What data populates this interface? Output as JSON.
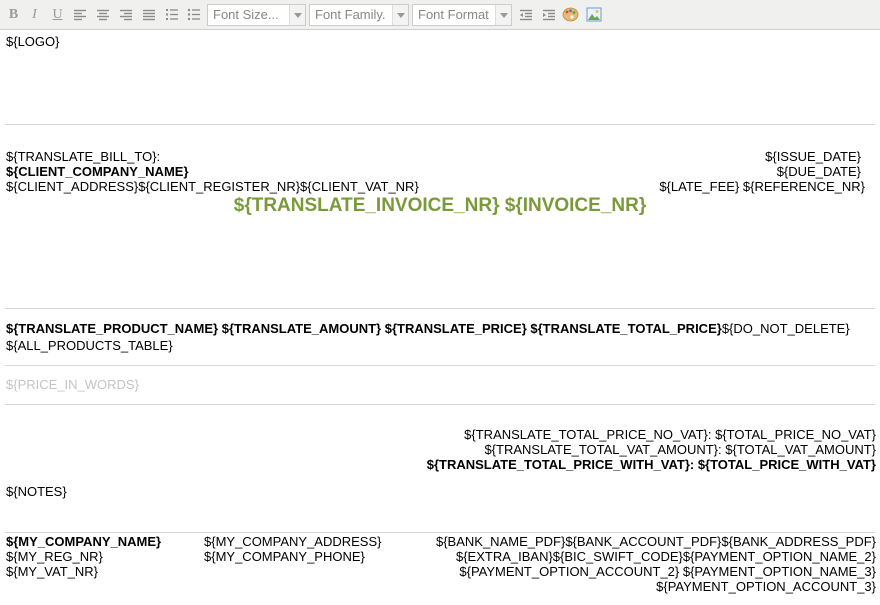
{
  "toolbar": {
    "font_size_placeholder": "Font Size...",
    "font_family_placeholder": "Font Family.",
    "font_format_placeholder": "Font Format",
    "icons": [
      "bold-icon",
      "italic-icon",
      "underline-icon",
      "align-left-icon",
      "align-center-icon",
      "align-right-icon",
      "justify-icon",
      "ordered-list-icon",
      "unordered-list-icon",
      "outdent-icon",
      "indent-icon",
      "color-palette-icon",
      "insert-image-icon"
    ]
  },
  "doc": {
    "logo": "${LOGO}",
    "bill_to": "${TRANSLATE_BILL_TO}:",
    "client_company": "${CLIENT_COMPANY_NAME}",
    "client_address": "${CLIENT_ADDRESS}${CLIENT_REGISTER_NR}${CLIENT_VAT_NR}",
    "issue_date": "${ISSUE_DATE}",
    "due_date": "${DUE_DATE}",
    "late_fee_ref": "${LATE_FEE} ${REFERENCE_NR}",
    "invoice_title": "${TRANSLATE_INVOICE_NR} ${INVOICE_NR}",
    "table_header_bold": "${TRANSLATE_PRODUCT_NAME} ${TRANSLATE_AMOUNT} ${TRANSLATE_PRICE} ${TRANSLATE_TOTAL_PRICE}",
    "table_header_rest": "${DO_NOT_DELETE}",
    "all_products": "${ALL_PRODUCTS_TABLE}",
    "price_in_words": "${PRICE_IN_WORDS}",
    "total_no_vat": "${TRANSLATE_TOTAL_PRICE_NO_VAT}: ${TOTAL_PRICE_NO_VAT}",
    "total_vat": "${TRANSLATE_TOTAL_VAT_AMOUNT}: ${TOTAL_VAT_AMOUNT}",
    "total_with_vat": "${TRANSLATE_TOTAL_PRICE_WITH_VAT}: ${TOTAL_PRICE_WITH_VAT}",
    "notes": "${NOTES}",
    "footer": {
      "col1": [
        "${MY_COMPANY_NAME}",
        "${MY_REG_NR}",
        "${MY_VAT_NR}"
      ],
      "col2": [
        "${MY_COMPANY_ADDRESS}",
        "${MY_COMPANY_PHONE}"
      ],
      "col3": [
        "${BANK_NAME_PDF}${BANK_ACCOUNT_PDF}${BANK_ADDRESS_PDF}",
        "${EXTRA_IBAN}${BIC_SWIFT_CODE}${PAYMENT_OPTION_NAME_2}",
        "${PAYMENT_OPTION_ACCOUNT_2} ${PAYMENT_OPTION_NAME_3}",
        "${PAYMENT_OPTION_ACCOUNT_3}"
      ]
    }
  },
  "colors": {
    "title_green": "#7a9a3a",
    "muted": "#c4c4c4"
  }
}
